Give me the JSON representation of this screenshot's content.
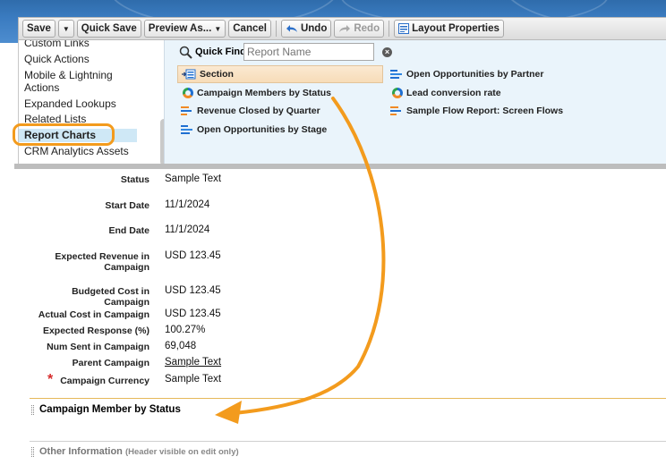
{
  "toolbar": {
    "save": "Save",
    "quick_save": "Quick Save",
    "preview_as": "Preview As...",
    "cancel": "Cancel",
    "undo": "Undo",
    "redo": "Redo",
    "layout_properties": "Layout Properties"
  },
  "categories": [
    "Custom Links",
    "Quick Actions",
    "Mobile & Lightning",
    "Actions",
    "Expanded Lookups",
    "Related Lists",
    "Report Charts",
    "CRM Analytics Assets"
  ],
  "quick_find": {
    "label": "Quick Find",
    "placeholder": "Report Name"
  },
  "palette_items": {
    "section": "Section",
    "campaign_members_by_status": "Campaign Members by Status",
    "revenue_closed_by_quarter": "Revenue Closed by Quarter",
    "open_opportunities_by_stage": "Open Opportunities by Stage",
    "open_opportunities_by_partner": "Open Opportunities by Partner",
    "lead_conversion_rate": "Lead conversion rate",
    "sample_flow_report": "Sample Flow Report: Screen Flows"
  },
  "fields": [
    {
      "label": "Status",
      "value": "Sample Text"
    },
    {
      "label": "Start Date",
      "value": "11/1/2024"
    },
    {
      "label": "End Date",
      "value": "11/1/2024"
    },
    {
      "label": "Expected Revenue in Campaign",
      "value": "USD 123.45"
    },
    {
      "label": "Budgeted Cost in Campaign",
      "value": "USD 123.45"
    },
    {
      "label": "Actual Cost in Campaign",
      "value": "USD 123.45"
    },
    {
      "label": "Expected Response (%)",
      "value": "100.27%"
    },
    {
      "label": "Num Sent in Campaign",
      "value": "69,048"
    },
    {
      "label": "Parent Campaign",
      "value": "Sample Text"
    },
    {
      "label": "Campaign Currency",
      "value": "Sample Text"
    }
  ],
  "sections": {
    "campaign_member_by_status": "Campaign Member by Status",
    "other_information": "Other Information",
    "other_information_note": "(Header visible on edit only)"
  },
  "colors": {
    "annotation": "#f39b1d",
    "required": "#d62b2b",
    "section_highlight": "#f7dcb8",
    "palette_bg": "#eaf4fb"
  }
}
